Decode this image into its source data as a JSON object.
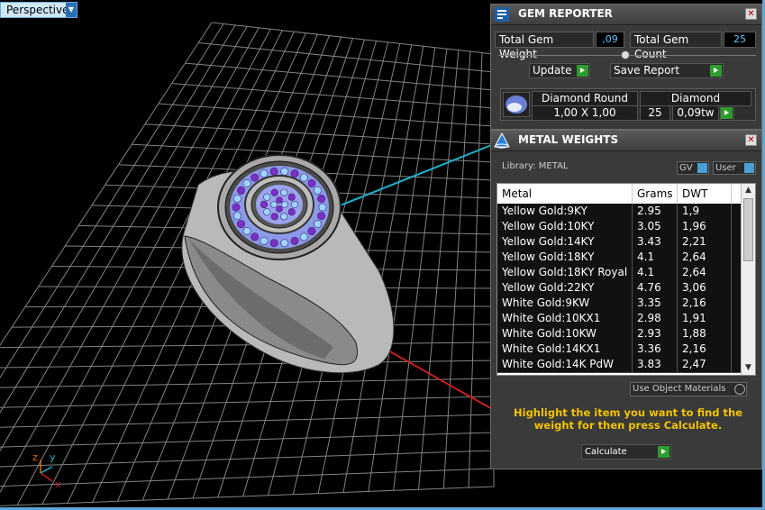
{
  "viewport": {
    "view_label": "Perspective",
    "axis_z": "z",
    "axis_y": "y",
    "axis_x": "x"
  },
  "gem_reporter": {
    "title": "GEM REPORTER",
    "total_weight_label": "Total Gem Weight",
    "total_weight_value": ",09",
    "total_count_label": "Total Gem Count",
    "total_count_value": "25",
    "update_label": "Update",
    "save_report_label": "Save Report",
    "gem": {
      "shape": "Diamond Round",
      "material": "Diamond",
      "size": "1,00 X 1,00",
      "count": "25",
      "weight": "0,09tw"
    }
  },
  "metal_weights": {
    "title": "METAL WEIGHTS",
    "library_label": "Library: METAL",
    "gv_label": "GV",
    "user_label": "User",
    "columns": [
      "Metal",
      "Grams",
      "DWT"
    ],
    "rows": [
      [
        "Yellow Gold:9KY",
        "2.95",
        "1,9"
      ],
      [
        "Yellow Gold:10KY",
        "3.05",
        "1,96"
      ],
      [
        "Yellow Gold:14KY",
        "3.43",
        "2,21"
      ],
      [
        "Yellow Gold:18KY",
        "4.1",
        "2,64"
      ],
      [
        "Yellow Gold:18KY Royal",
        "4.1",
        "2,64"
      ],
      [
        "Yellow Gold:22KY",
        "4.76",
        "3,06"
      ],
      [
        "White Gold:9KW",
        "3.35",
        "2,16"
      ],
      [
        "White Gold:10KX1",
        "2.98",
        "1,91"
      ],
      [
        "White Gold:10KW",
        "2.93",
        "1,88"
      ],
      [
        "White Gold:14KX1",
        "3.36",
        "2,16"
      ],
      [
        "White Gold:14K PdW",
        "3.83",
        "2,47"
      ]
    ],
    "use_object_materials_label": "Use Object Materials",
    "hint": "Highlight the item you want to find the weight for then press Calculate.",
    "calculate_label": "Calculate"
  }
}
